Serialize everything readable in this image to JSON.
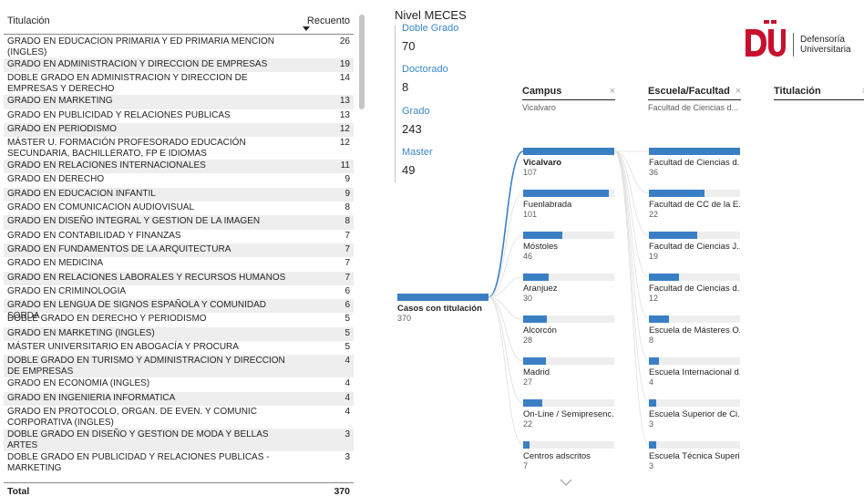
{
  "table": {
    "header_title": "Titulación",
    "header_count": "Recuento",
    "rows": [
      {
        "t": "GRADO EN EDUCACION PRIMARIA Y ED PRIMARIA MENCION (INGLES)",
        "c": "26"
      },
      {
        "t": "GRADO EN ADMINISTRACION Y DIRECCION DE EMPRESAS",
        "c": "19"
      },
      {
        "t": "DOBLE GRADO EN ADMINISTRACION Y DIRECCION DE EMPRESAS Y DERECHO",
        "c": "14"
      },
      {
        "t": "GRADO EN MARKETING",
        "c": "13"
      },
      {
        "t": "GRADO EN PUBLICIDAD Y RELACIONES PUBLICAS",
        "c": "13"
      },
      {
        "t": "GRADO EN PERIODISMO",
        "c": "12"
      },
      {
        "t": "MÁSTER U. FORMACIÓN PROFESORADO EDUCACIÓN SECUNDARIA, BACHILLERATO, FP E IDIOMAS",
        "c": "12"
      },
      {
        "t": "GRADO EN RELACIONES INTERNACIONALES",
        "c": "11"
      },
      {
        "t": "GRADO EN DERECHO",
        "c": "9"
      },
      {
        "t": "GRADO EN EDUCACION INFANTIL",
        "c": "9"
      },
      {
        "t": "GRADO EN COMUNICACION AUDIOVISUAL",
        "c": "8"
      },
      {
        "t": "GRADO EN DISEÑO INTEGRAL Y GESTION DE LA IMAGEN",
        "c": "8"
      },
      {
        "t": "GRADO EN CONTABILIDAD Y FINANZAS",
        "c": "7"
      },
      {
        "t": "GRADO EN FUNDAMENTOS DE LA ARQUITECTURA",
        "c": "7"
      },
      {
        "t": "GRADO EN MEDICINA",
        "c": "7"
      },
      {
        "t": "GRADO EN RELACIONES LABORALES Y RECURSOS HUMANOS",
        "c": "7"
      },
      {
        "t": "GRADO EN CRIMINOLOGIA",
        "c": "6"
      },
      {
        "t": "GRADO EN LENGUA DE SIGNOS ESPAÑOLA Y COMUNIDAD SORDA",
        "c": "6"
      },
      {
        "t": "DOBLE GRADO EN DERECHO Y PERIODISMO",
        "c": "5"
      },
      {
        "t": "GRADO EN MARKETING (INGLES)",
        "c": "5"
      },
      {
        "t": "MÁSTER UNIVERSITARIO EN ABOGACÍA Y PROCURA",
        "c": "5"
      },
      {
        "t": "DOBLE GRADO EN TURISMO Y ADMINISTRACION Y DIRECCION DE EMPRESAS",
        "c": "4"
      },
      {
        "t": "GRADO EN ECONOMIA (INGLES)",
        "c": "4"
      },
      {
        "t": "GRADO EN INGENIERIA INFORMATICA",
        "c": "4"
      },
      {
        "t": "GRADO EN PROTOCOLO, ORGAN. DE EVEN. Y COMUNIC CORPORATIVA (INGLES)",
        "c": "4"
      },
      {
        "t": "DOBLE GRADO EN DISEÑO Y GESTION DE MODA Y BELLAS ARTES",
        "c": "3"
      },
      {
        "t": "DOBLE GRADO EN PUBLICIDAD Y RELACIONES PUBLICAS - MARKETING",
        "c": "3"
      }
    ],
    "total_label": "Total",
    "total_value": "370"
  },
  "meces": {
    "title": "Nivel MECES",
    "items": [
      {
        "label": "Doble Grado",
        "value": "70"
      },
      {
        "label": "Doctorado",
        "value": "8"
      },
      {
        "label": "Grado",
        "value": "243"
      },
      {
        "label": "Master",
        "value": "49"
      }
    ]
  },
  "logo": {
    "mark": "DU",
    "line1": "Defensoría",
    "line2": "Universitaria",
    "brand_color": "#c8102e"
  },
  "tree": {
    "columns": [
      {
        "title": "Campus",
        "subtitle": "Vicalvaro"
      },
      {
        "title": "Escuela/Facultad",
        "subtitle": "Facultad de Ciencias d..."
      },
      {
        "title": "Titulación",
        "subtitle": ""
      }
    ],
    "root": {
      "label": "Casos con titulación",
      "value": "370",
      "num": 370
    },
    "campus": [
      {
        "label": "Vicalvaro",
        "value": "107",
        "num": 107
      },
      {
        "label": "Fuenlabrada",
        "value": "101",
        "num": 101
      },
      {
        "label": "Móstoles",
        "value": "46",
        "num": 46
      },
      {
        "label": "Aranjuez",
        "value": "30",
        "num": 30
      },
      {
        "label": "Alcorcón",
        "value": "28",
        "num": 28
      },
      {
        "label": "Madrid",
        "value": "27",
        "num": 27
      },
      {
        "label": "On-Line / Semipresenc...",
        "value": "22",
        "num": 22
      },
      {
        "label": "Centros adscritos",
        "value": "7",
        "num": 7
      }
    ],
    "escuela": [
      {
        "label": "Facultad de Ciencias d...",
        "value": "36",
        "num": 36
      },
      {
        "label": "Facultad de CC de la E...",
        "value": "22",
        "num": 22
      },
      {
        "label": "Facultad de Ciencias J...",
        "value": "19",
        "num": 19
      },
      {
        "label": "Facultad de Ciencias d...",
        "value": "12",
        "num": 12
      },
      {
        "label": "Escuela de Másteres O...",
        "value": "8",
        "num": 8
      },
      {
        "label": "Escuela Internacional d...",
        "value": "4",
        "num": 4
      },
      {
        "label": "Escuela Superior de Ci...",
        "value": "3",
        "num": 3
      },
      {
        "label": "Escuela Técnica Superi...",
        "value": "3",
        "num": 3
      }
    ],
    "bar_color": "#3a7fc4",
    "close_glyph": "×"
  }
}
